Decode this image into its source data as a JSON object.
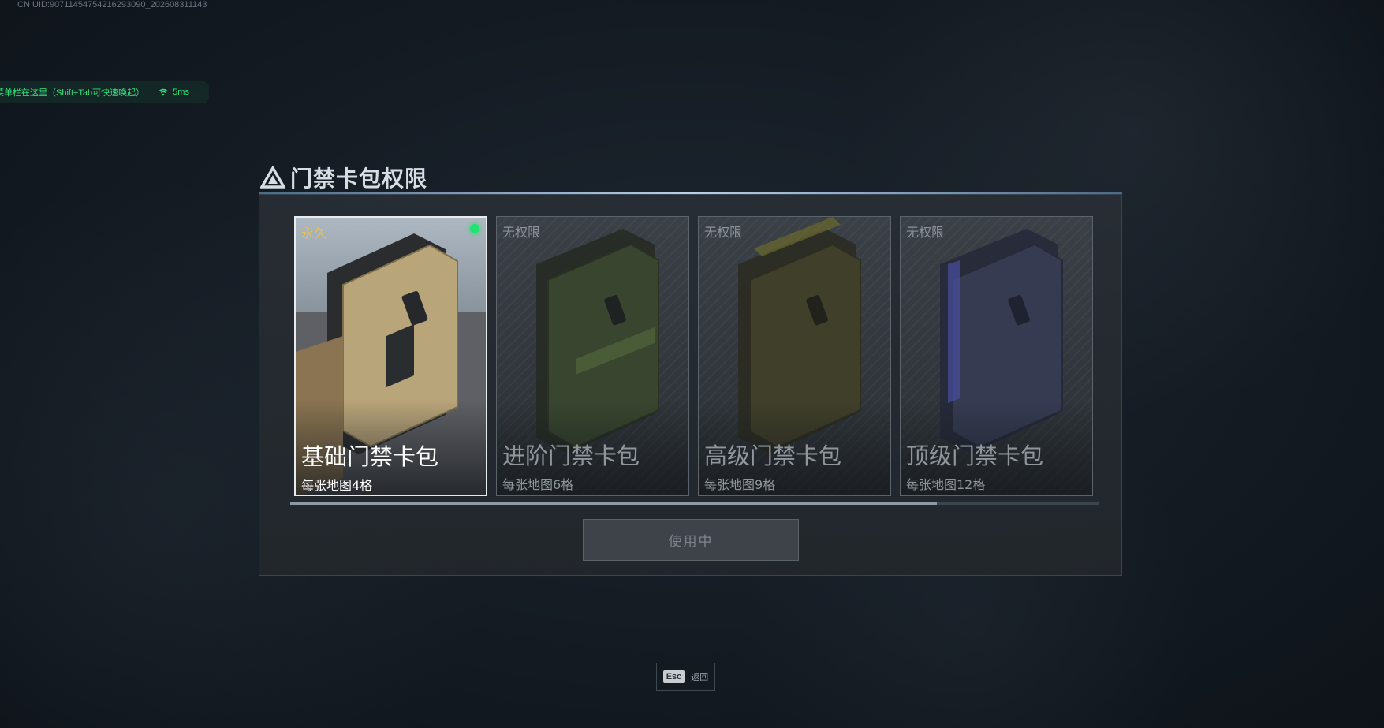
{
  "overlay": {
    "uid": "CN UID:9071145475421629309​0_202608311143",
    "hint": "菜单栏在这里（Shift+Tab可快速唤起）",
    "ping": "5ms"
  },
  "panel": {
    "title": "门禁卡包权限",
    "use_button": "使用中",
    "scroll_progress": 0.8
  },
  "cards": [
    {
      "tag": "永久",
      "name": "基础门禁卡包",
      "sub": "每张地图4格",
      "active": true,
      "color": "#b8a27a"
    },
    {
      "tag": "无权限",
      "name": "进阶门禁卡包",
      "sub": "每张地图6格",
      "active": false,
      "color": "#3b4a33"
    },
    {
      "tag": "无权限",
      "name": "高级门禁卡包",
      "sub": "每张地图9格",
      "active": false,
      "color": "#4d4d2c"
    },
    {
      "tag": "无权限",
      "name": "顶级门禁卡包",
      "sub": "每张地图12格",
      "active": false,
      "color": "#3a3f5a"
    }
  ],
  "footer": {
    "key": "Esc",
    "label": "返回"
  },
  "colors": {
    "active_dot": "#22e36f",
    "permanent_tag": "#e8c24a",
    "hint_text": "#36e07c"
  }
}
